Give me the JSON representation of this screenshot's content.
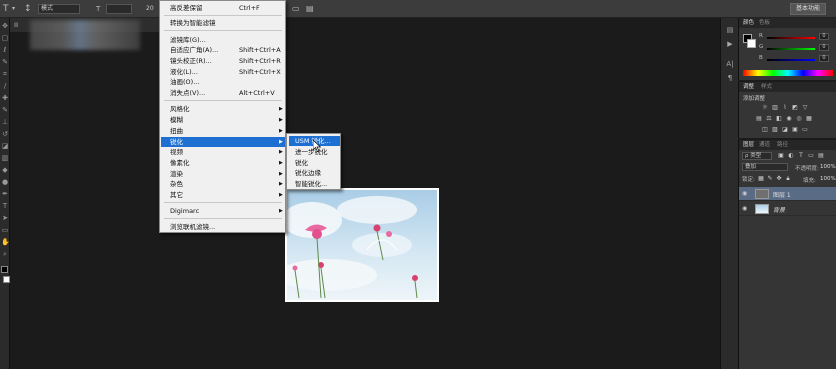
{
  "options_bar": {
    "mode_combo": "模式",
    "size_value": "20",
    "workspace_button": "基本功能"
  },
  "doc_tab": {
    "label": "Ⅲ"
  },
  "filter_menu": {
    "items": [
      {
        "label": "高反差保留",
        "shortcut": "Ctrl+F"
      },
      {
        "label": "转换为智能滤镜",
        "shortcut": ""
      },
      {
        "label": "滤镜库(G)...",
        "shortcut": ""
      },
      {
        "label": "自适应广角(A)...",
        "shortcut": "Shift+Ctrl+A"
      },
      {
        "label": "镜头校正(R)...",
        "shortcut": "Shift+Ctrl+R"
      },
      {
        "label": "液化(L)...",
        "shortcut": "Shift+Ctrl+X"
      },
      {
        "label": "油画(O)...",
        "shortcut": ""
      },
      {
        "label": "消失点(V)...",
        "shortcut": "Alt+Ctrl+V"
      },
      {
        "label": "风格化",
        "shortcut": ""
      },
      {
        "label": "模糊",
        "shortcut": ""
      },
      {
        "label": "扭曲",
        "shortcut": ""
      },
      {
        "label": "锐化",
        "shortcut": ""
      },
      {
        "label": "视频",
        "shortcut": ""
      },
      {
        "label": "像素化",
        "shortcut": ""
      },
      {
        "label": "渲染",
        "shortcut": ""
      },
      {
        "label": "杂色",
        "shortcut": ""
      },
      {
        "label": "其它",
        "shortcut": ""
      },
      {
        "label": "Digimarc",
        "shortcut": ""
      },
      {
        "label": "浏览联机滤镜...",
        "shortcut": ""
      }
    ]
  },
  "sharpen_submenu": {
    "items": [
      "USM 锐化...",
      "进一步锐化",
      "锐化",
      "锐化边缘",
      "智能锐化..."
    ]
  },
  "color_panel": {
    "tabs": [
      "颜色",
      "色板"
    ],
    "r_value": "0",
    "g_value": "0",
    "b_value": "0",
    "r_label": "R",
    "g_label": "G",
    "b_label": "B"
  },
  "adjustments_panel": {
    "tabs": [
      "调整",
      "样式"
    ],
    "title": "添加调整"
  },
  "layers_panel": {
    "tabs": [
      "图层",
      "通道",
      "路径"
    ],
    "kind_filter": "ρ 类型",
    "blend_mode": "叠加",
    "opacity_label": "不透明度:",
    "opacity_value": "100%",
    "lock_label": "锁定:",
    "fill_label": "填充:",
    "fill_value": "100%",
    "layers": [
      {
        "name": "图层 1",
        "selected": true
      },
      {
        "name": "背景",
        "selected": false
      }
    ]
  },
  "colors": {
    "highlight": "#1e6fd2",
    "menu_bg": "#f0f0f0",
    "app_bg": "#1b1b1b",
    "panel_bg": "#353535",
    "layer_selected": "#5a6b86"
  }
}
